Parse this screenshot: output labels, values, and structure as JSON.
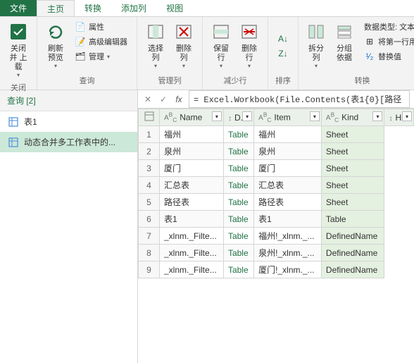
{
  "tabs": {
    "file": "文件",
    "home": "主页",
    "transform": "转换",
    "addcol": "添加列",
    "view": "视图"
  },
  "ribbon": {
    "close_group": "关闭",
    "close_upload": "关闭并\n上载",
    "query_group": "查询",
    "refresh": "刷新\n预览",
    "props": "属性",
    "adv_editor": "高级编辑器",
    "manage": "管理",
    "managecols_group": "管理列",
    "select_cols": "选择\n列",
    "remove_cols": "删除\n列",
    "reducerows_group": "减少行",
    "keep_rows": "保留\n行",
    "remove_rows": "删除\n行",
    "sort_group": "排序",
    "split_col": "拆分\n列",
    "groupby": "分组\n依据",
    "transform_group": "转换",
    "datatype": "数据类型: 文本",
    "firstrow_header": "将第一行用",
    "replace": "替换值"
  },
  "sidebar": {
    "header": "查询 [2]",
    "items": [
      "表1",
      "动态合并多工作表中的..."
    ]
  },
  "formula": "= Excel.Workbook(File.Contents(表1{0}[路径",
  "columns": [
    "",
    "Name",
    "D...",
    "Item",
    "Kind",
    "Hid"
  ],
  "col_types": [
    "index",
    "text",
    "expand",
    "text",
    "text",
    "expand"
  ],
  "rows": [
    {
      "n": 1,
      "name": "福州",
      "data": "Table",
      "item": "福州",
      "kind": "Sheet"
    },
    {
      "n": 2,
      "name": "泉州",
      "data": "Table",
      "item": "泉州",
      "kind": "Sheet"
    },
    {
      "n": 3,
      "name": "厦门",
      "data": "Table",
      "item": "厦门",
      "kind": "Sheet"
    },
    {
      "n": 4,
      "name": "汇总表",
      "data": "Table",
      "item": "汇总表",
      "kind": "Sheet"
    },
    {
      "n": 5,
      "name": "路径表",
      "data": "Table",
      "item": "路径表",
      "kind": "Sheet"
    },
    {
      "n": 6,
      "name": "表1",
      "data": "Table",
      "item": "表1",
      "kind": "Table"
    },
    {
      "n": 7,
      "name": "_xlnm._Filte...",
      "data": "Table",
      "item": "福州!_xlnm._...",
      "kind": "DefinedName"
    },
    {
      "n": 8,
      "name": "_xlnm._Filte...",
      "data": "Table",
      "item": "泉州!_xlnm._...",
      "kind": "DefinedName"
    },
    {
      "n": 9,
      "name": "_xlnm._Filte...",
      "data": "Table",
      "item": "厦门!_xlnm._...",
      "kind": "DefinedName"
    }
  ]
}
